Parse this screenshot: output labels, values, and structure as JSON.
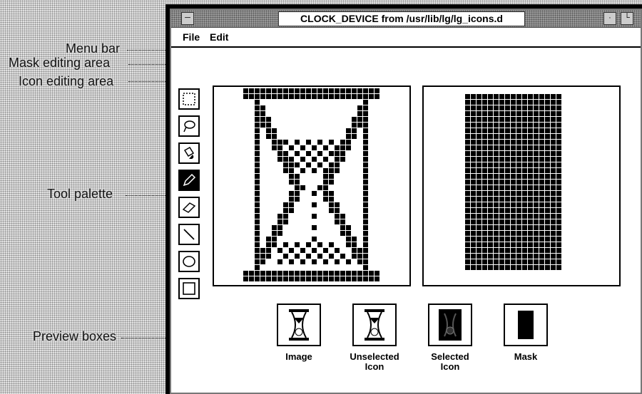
{
  "window": {
    "title": "CLOCK_DEVICE from /usr/lib/lg/lg_icons.d"
  },
  "menu": {
    "file": "File",
    "edit": "Edit"
  },
  "callouts": {
    "menu_bar": "Menu bar",
    "mask_area": "Mask editing area",
    "icon_area": "Icon editing area",
    "tool_palette": "Tool palette",
    "preview_boxes": "Preview boxes"
  },
  "tools": [
    {
      "name": "select-rect-tool",
      "icon": "dashed-rectangle-icon",
      "active": false
    },
    {
      "name": "lasso-tool",
      "icon": "lasso-icon",
      "active": false
    },
    {
      "name": "fill-tool",
      "icon": "paint-bucket-icon",
      "active": false
    },
    {
      "name": "pencil-tool",
      "icon": "pencil-icon",
      "active": true
    },
    {
      "name": "eraser-tool",
      "icon": "eraser-icon",
      "active": false
    },
    {
      "name": "line-tool",
      "icon": "line-icon",
      "active": false
    },
    {
      "name": "oval-tool",
      "icon": "oval-icon",
      "active": false
    },
    {
      "name": "rectangle-tool",
      "icon": "rectangle-icon",
      "active": false
    }
  ],
  "previews": {
    "image": {
      "line1": "Image",
      "line2": ""
    },
    "unselected": {
      "line1": "Unselected",
      "line2": "Icon"
    },
    "selected": {
      "line1": "Selected",
      "line2": "Icon"
    },
    "mask": {
      "line1": "Mask",
      "line2": ""
    }
  }
}
